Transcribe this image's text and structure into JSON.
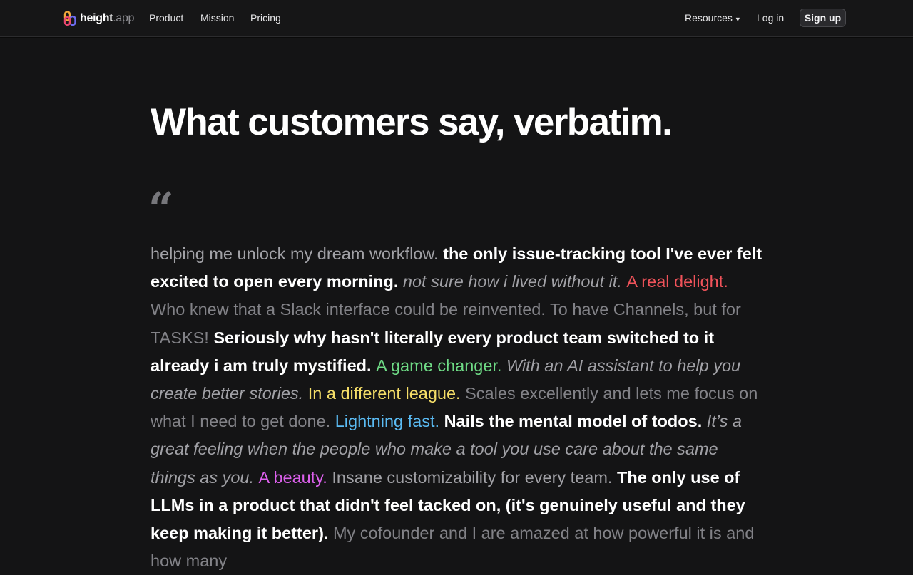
{
  "nav": {
    "brand_name": "height",
    "brand_suffix": ".app",
    "links": [
      "Product",
      "Mission",
      "Pricing"
    ],
    "resources_label": "Resources",
    "login_label": "Log in",
    "signup_label": "Sign up"
  },
  "hero": {
    "title": "What customers say, verbatim.",
    "quote_mark": "“"
  },
  "quote": {
    "segments": [
      {
        "style": "light",
        "text": "helping me unlock my dream workflow. "
      },
      {
        "style": "bold",
        "text": "the only issue-tracking tool I've ever felt excited to open every morning. "
      },
      {
        "style": "italic",
        "text": "not sure how i lived without it. "
      },
      {
        "style": "red",
        "text": "A real delight. "
      },
      {
        "style": "muted",
        "text": "Who knew that a Slack interface could be reinvented. To have Channels, but for TASKS! "
      },
      {
        "style": "bold",
        "text": "Seriously why hasn't literally every product team switched to it already i am truly mystified. "
      },
      {
        "style": "green",
        "text": "A game changer. "
      },
      {
        "style": "italic",
        "text": "With an AI assistant to help you create better stories. "
      },
      {
        "style": "yellow",
        "text": "In a different league. "
      },
      {
        "style": "muted",
        "text": "Scales excellently and lets me focus on what I need to get done. "
      },
      {
        "style": "blue",
        "text": "Lightning fast. "
      },
      {
        "style": "bold",
        "text": "Nails the mental model of todos. "
      },
      {
        "style": "italic",
        "text": "It’s a great feeling when the people who make a tool you use care about the same things as you. "
      },
      {
        "style": "pink",
        "text": "A beauty. "
      },
      {
        "style": "light",
        "text": "Insane customizability for every team. "
      },
      {
        "style": "bold",
        "text": "The only use of LLMs in a product that didn't feel tacked on, (it's genuinely useful and they keep making it better). "
      },
      {
        "style": "muted",
        "text": "My cofounder and I are amazed at how powerful it is and how many"
      }
    ]
  },
  "colors": {
    "background": "#141415",
    "red": "#f0535a",
    "green": "#6fdc86",
    "yellow": "#f5de68",
    "blue": "#5bbcf4",
    "pink": "#dc60ec"
  }
}
